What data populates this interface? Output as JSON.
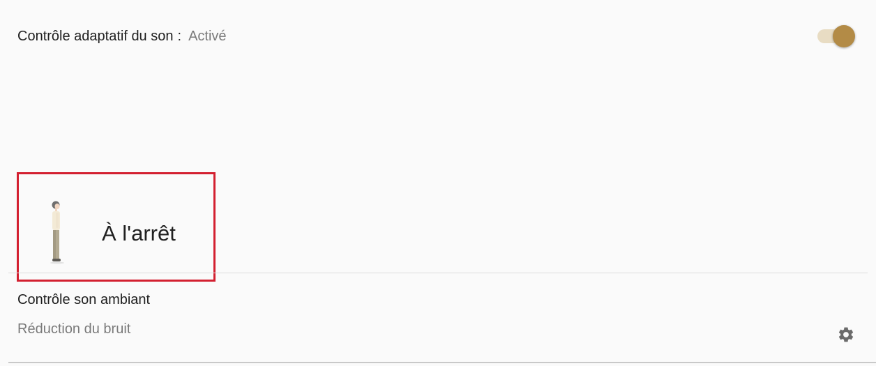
{
  "adaptive_sound": {
    "label": "Contrôle adaptatif du son",
    "separator": ":",
    "status": "Activé",
    "toggle_on": true,
    "toggle_color": "#b38b46"
  },
  "activity": {
    "label": "À l'arrêt",
    "icon": "standing-person-icon",
    "highlight_color": "#d32030"
  },
  "ambient": {
    "title": "Contrôle son ambiant",
    "mode": "Réduction du bruit",
    "settings_icon": "gear-icon"
  }
}
